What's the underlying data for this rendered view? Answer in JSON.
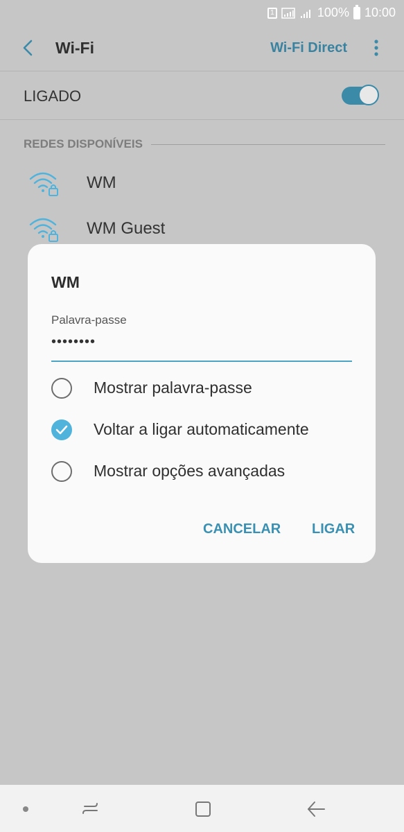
{
  "status_bar": {
    "sim_label": "1",
    "battery": "100%",
    "time": "10:00",
    "icons": [
      "sim-icon",
      "signal-icon",
      "signal-icon",
      "battery-icon"
    ]
  },
  "header": {
    "title": "Wi-Fi",
    "wifi_direct": "Wi-Fi Direct",
    "icons": [
      "back-arrow-icon",
      "more-vert-icon"
    ]
  },
  "wifi_toggle": {
    "label": "LIGADO",
    "state": "on"
  },
  "networks": {
    "section_label": "REDES DISPONÍVEIS",
    "items": [
      {
        "name": "WM",
        "icon": "wifi-locked-icon"
      },
      {
        "name": "WM Guest",
        "icon": "wifi-locked-icon"
      }
    ]
  },
  "dialog": {
    "title": "WM",
    "password_label": "Palavra-passe",
    "password_value": "••••••••",
    "options": [
      {
        "label": "Mostrar palavra-passe",
        "checked": false
      },
      {
        "label": "Voltar a ligar automaticamente",
        "checked": true
      },
      {
        "label": "Mostrar opções avançadas",
        "checked": false
      }
    ],
    "cancel_label": "CANCELAR",
    "connect_label": "LIGAR"
  },
  "navigation_bar": {
    "icons": [
      "nav-dot-icon",
      "recents-icon",
      "home-icon",
      "back-icon"
    ]
  },
  "colors": {
    "accent": "#3a8aa8",
    "overlay_background": "#c6c6c6",
    "dialog_background": "#fafafa",
    "checkbox_checked": "#4fb3dc"
  }
}
